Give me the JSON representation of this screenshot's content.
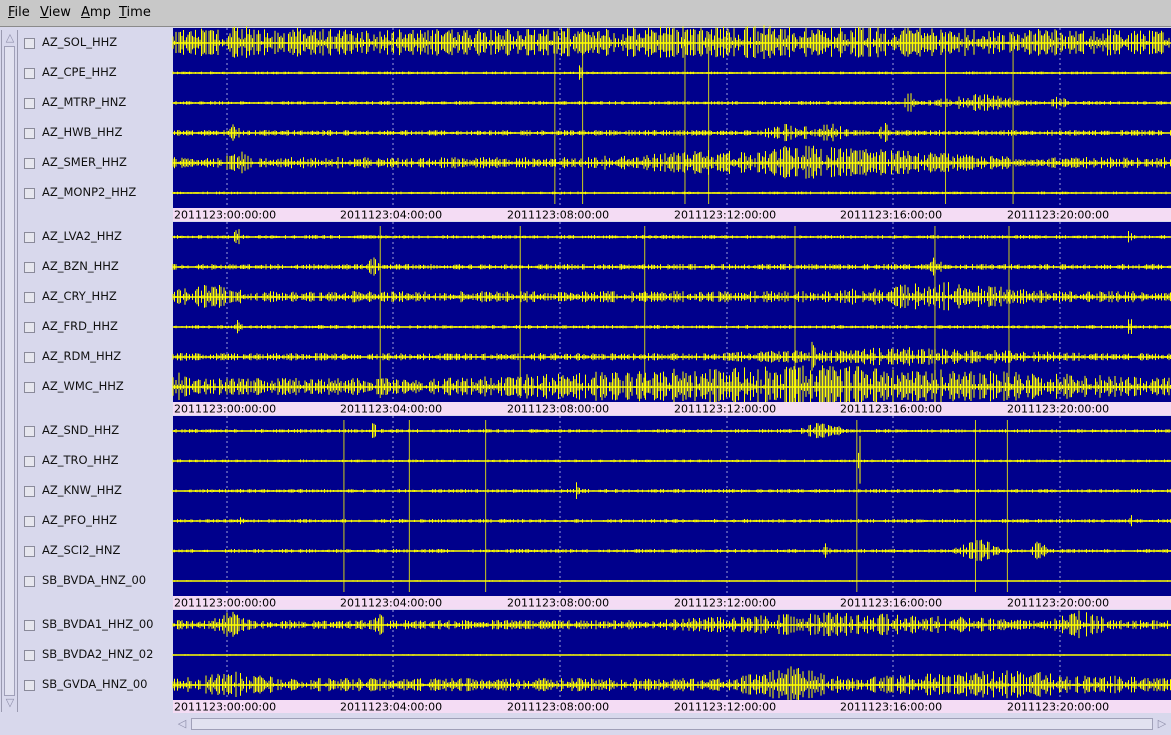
{
  "menu": [
    "File",
    "View",
    "Amp",
    "Time"
  ],
  "colors": {
    "trace_background": "#00008c",
    "trace": "#ffff00",
    "time_axis_band": "#f4dcf4",
    "grid_dotted": "#a0a0d8"
  },
  "icons": {
    "scroll_up": "triangle-up-icon",
    "scroll_down": "triangle-down-icon",
    "scroll_left": "triangle-left-icon",
    "scroll_right": "triangle-right-icon"
  },
  "groups": [
    {
      "channels": [
        "AZ_SOL_HHZ",
        "AZ_CPE_HHZ",
        "AZ_MTRP_HNZ",
        "AZ_HWB_HHZ",
        "AZ_SMER_HHZ",
        "AZ_MONP2_HHZ"
      ],
      "time_labels": [
        "2011123:00:00:00",
        "2011123:04:00:00",
        "2011123:08:00:00",
        "2011123:12:00:00",
        "2011123:16:00:00",
        "2011123:20:00:00"
      ]
    },
    {
      "channels": [
        "AZ_LVA2_HHZ",
        "AZ_BZN_HHZ",
        "AZ_CRY_HHZ",
        "AZ_FRD_HHZ",
        "AZ_RDM_HHZ",
        "AZ_WMC_HHZ"
      ],
      "time_labels": [
        "2011123:00:00:00",
        "2011123:04:00:00",
        "2011123:08:00:00",
        "2011123:12:00:00",
        "2011123:16:00:00",
        "2011123:20:00:00"
      ]
    },
    {
      "channels": [
        "AZ_SND_HHZ",
        "AZ_TRO_HHZ",
        "AZ_KNW_HHZ",
        "AZ_PFO_HHZ",
        "AZ_SCI2_HNZ",
        "SB_BVDA_HNZ_00"
      ],
      "time_labels": [
        "2011123:00:00:00",
        "2011123:04:00:00",
        "2011123:08:00:00",
        "2011123:12:00:00",
        "2011123:16:00:00",
        "2011123:20:00:00"
      ]
    },
    {
      "channels": [
        "SB_BVDA1_HHZ_00",
        "SB_BVDA2_HNZ_02",
        "SB_GVDA_HNZ_00"
      ],
      "time_labels": [
        "2011123:00:00:00",
        "2011123:04:00:00",
        "2011123:08:00:00",
        "2011123:12:00:00",
        "2011123:16:00:00",
        "2011123:20:00:00"
      ]
    }
  ]
}
